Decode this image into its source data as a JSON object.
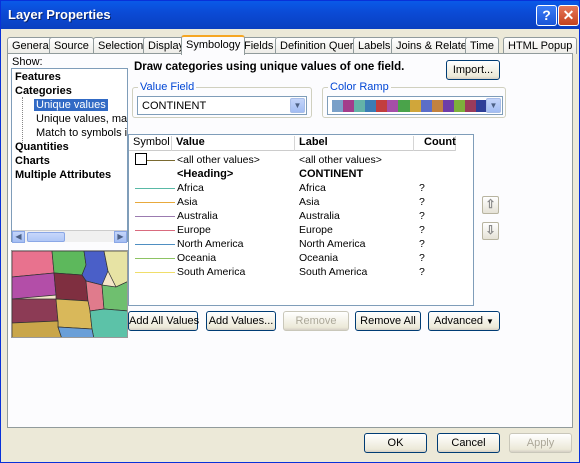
{
  "window": {
    "title": "Layer Properties"
  },
  "tabs": [
    "General",
    "Source",
    "Selection",
    "Display",
    "Symbology",
    "Fields",
    "Definition Query",
    "Labels",
    "Joins & Relates",
    "Time",
    "HTML Popup"
  ],
  "active_tab": "Symbology",
  "show": {
    "label": "Show:",
    "items": [
      {
        "label": "Features"
      },
      {
        "label": "Categories"
      },
      {
        "label": "Unique values"
      },
      {
        "label": "Unique values, many"
      },
      {
        "label": "Match to symbols in a"
      },
      {
        "label": "Quantities"
      },
      {
        "label": "Charts"
      },
      {
        "label": "Multiple Attributes"
      }
    ]
  },
  "description": "Draw categories using unique values of one field.",
  "import_label": "Import...",
  "value_field": {
    "legend": "Value Field",
    "value": "CONTINENT"
  },
  "color_ramp": {
    "legend": "Color Ramp",
    "colors": [
      "#7aa0c8",
      "#a33d8b",
      "#63b3a8",
      "#3b7db5",
      "#c23e3e",
      "#a64ea8",
      "#4aa34a",
      "#d0a63a",
      "#5b6ec8",
      "#c2823f",
      "#6e3ea8",
      "#7db03b",
      "#9a3b5b",
      "#2e3e98"
    ]
  },
  "table": {
    "headers": {
      "symbol": "Symbol",
      "value": "Value",
      "label": "Label",
      "count": "Count"
    },
    "rows": [
      {
        "value": "<all other values>",
        "label": "<all other values>",
        "count": "",
        "color": "#000000"
      },
      {
        "value": "<Heading>",
        "label": "CONTINENT",
        "count": "",
        "color": ""
      },
      {
        "value": "Africa",
        "label": "Africa",
        "count": "?",
        "color": "#59b9a6"
      },
      {
        "value": "Asia",
        "label": "Asia",
        "count": "?",
        "color": "#e8a93c"
      },
      {
        "value": "Australia",
        "label": "Australia",
        "count": "?",
        "color": "#9b7bb0"
      },
      {
        "value": "Europe",
        "label": "Europe",
        "count": "?",
        "color": "#d96b7e"
      },
      {
        "value": "North America",
        "label": "North America",
        "count": "?",
        "color": "#4f8fc2"
      },
      {
        "value": "Oceania",
        "label": "Oceania",
        "count": "?",
        "color": "#8dc363"
      },
      {
        "value": "South America",
        "label": "South America",
        "count": "?",
        "color": "#f0de6a"
      }
    ]
  },
  "buttons": {
    "add_all": "Add All Values",
    "add_values": "Add Values...",
    "remove": "Remove",
    "remove_all": "Remove All",
    "advanced": "Advanced"
  },
  "footer": {
    "ok": "OK",
    "cancel": "Cancel",
    "apply": "Apply"
  }
}
